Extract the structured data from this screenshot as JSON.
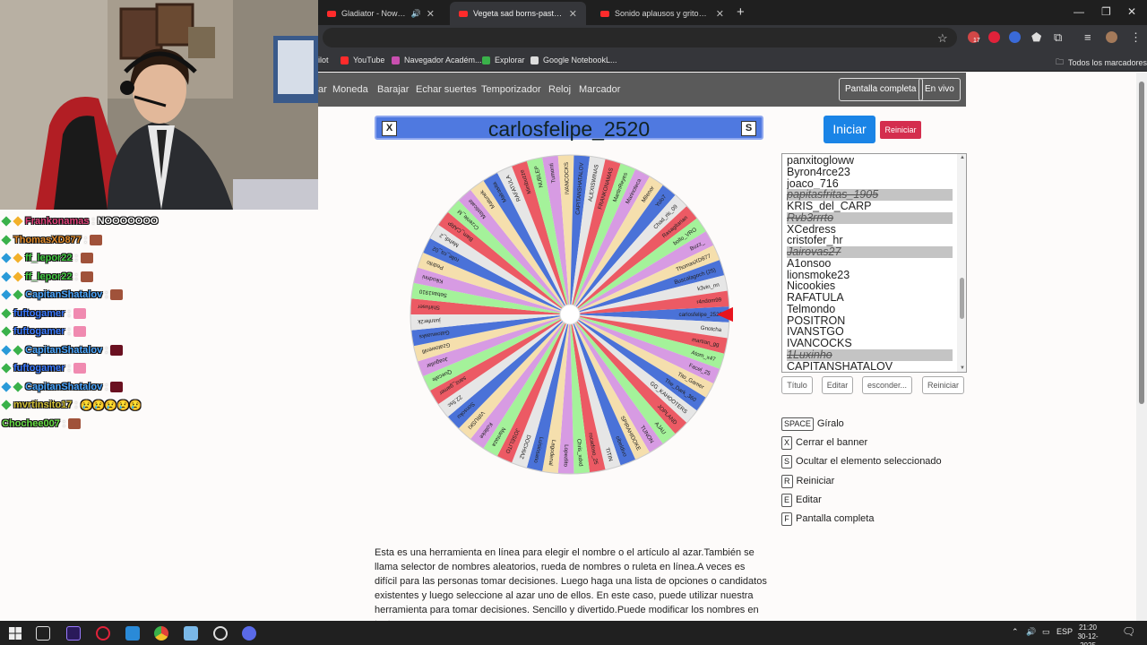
{
  "browser": {
    "tabs": [
      {
        "title": "Gladiator - Now We Are Free",
        "audio": true,
        "active": false
      },
      {
        "title": "Vegeta sad borns-past live (slowed)",
        "audio": false,
        "active": true
      },
      {
        "title": "Sonido aplausos y gritos del público",
        "audio": false,
        "active": false
      }
    ],
    "new_tab": "+",
    "window_controls": {
      "minimize": "—",
      "restore": "❐",
      "close": "✕"
    },
    "bookmarks": [
      {
        "label": "ilot",
        "color": "#6aa0ff"
      },
      {
        "label": "YouTube",
        "color": "#ff2b2b"
      },
      {
        "label": "Navegador Académ...",
        "color": "#c94fb0"
      },
      {
        "label": "Explorar",
        "color": "#3ab14a"
      },
      {
        "label": "Google NotebookL...",
        "color": "#dddddd"
      }
    ],
    "all_bookmarks": "Todos los marcadores",
    "extension_badge": "17"
  },
  "nav": {
    "links": [
      "ar",
      "Moneda",
      "Barajar",
      "Echar suertes",
      "Temporizador",
      "Reloj",
      "Marcador"
    ],
    "fullscreen_button": "Pantalla completa",
    "live_button": "En vivo"
  },
  "banner": {
    "title": "carlosfelipe_2520",
    "close_key": "X",
    "hide_key": "S"
  },
  "wheel": {
    "colors": [
      "#4a72d8",
      "#e6e6e6",
      "#ec5a64",
      "#a4f29a",
      "#d79be3",
      "#f5dfad"
    ],
    "pointer_color": "#e8141e",
    "selected": "carlosfelipe_2520",
    "labels": [
      "carlosfelipe_2520",
      "Gnotcha",
      "martian_gg",
      "Atom_x47",
      "Facel_25",
      "Tito_Gamer",
      "The_Dark_360",
      "GG_KAHOOTERS",
      "JOPLAND",
      "AJAU",
      "TUNON",
      "SPIRAHIDOKE",
      "cibeldivo",
      "TITIN",
      "rocadoso_25",
      "Chris_xdxd",
      "Lopezlito",
      "Lagodenal",
      "Luisinsano",
      "DOCHIAZ",
      "JOSELITO",
      "Mantaza",
      "Kolleke",
      "VIRUSKI",
      "Sonsoku",
      "22.5sc",
      "sanz_gamer",
      "Quecafe",
      "Joaguilar",
      "Gzatowenlll",
      "Gatowuasks",
      "juanfer2k",
      "Shirfuser",
      "Sebas1910",
      "Kikodrini",
      "Pedrito",
      "rolle_ca_02",
      "Mehdi_2",
      "Bam_CARP",
      "Crzenie_M",
      "Masticate",
      "Matunek",
      "Malrasita",
      "RAFATULA",
      "Minibuzze",
      "NUBLEP",
      "Tumonti",
      "IVANCOCKS",
      "CAPITANSHATALOV",
      "ALEXISWINAS",
      "FRANKONAMAS",
      "MartinReyes",
      "Marinoteca",
      "Milenor",
      "Yolo7",
      "Chad_ris_09",
      "Rasagitarian",
      "bollo_VRO",
      "Buzz_",
      "ThomasXD877",
      "Buscalagoch (25)",
      "k3vin_nn",
      "r4ndom99"
    ]
  },
  "controls": {
    "start": "Iniciar",
    "reset": "Reiniciar"
  },
  "entries": [
    {
      "text": "panxitogloww",
      "struck": false
    },
    {
      "text": "Byron4rce23",
      "struck": false
    },
    {
      "text": "joaco_716",
      "struck": false
    },
    {
      "text": "papitasfritas_1905",
      "struck": true
    },
    {
      "text": "KRIS_del_CARP",
      "struck": false
    },
    {
      "text": "Rvb3rrrto",
      "struck": true
    },
    {
      "text": "XCedress",
      "struck": false
    },
    {
      "text": "cristofer_hr",
      "struck": false
    },
    {
      "text": "Jairovas27",
      "struck": true
    },
    {
      "text": "A1onsoo",
      "struck": false
    },
    {
      "text": "lionsmoke23",
      "struck": false
    },
    {
      "text": "Nicookies",
      "struck": false
    },
    {
      "text": "RAFATULA",
      "struck": false
    },
    {
      "text": "Telmondo",
      "struck": false
    },
    {
      "text": "POSITRON",
      "struck": false
    },
    {
      "text": "IVANSTGO",
      "struck": false
    },
    {
      "text": "IVANCOCKS",
      "struck": false
    },
    {
      "text": "1Luxinho",
      "struck": true
    },
    {
      "text": "CAPITANSHATALOV",
      "struck": false
    }
  ],
  "list_buttons": {
    "title": "Título",
    "edit": "Editar",
    "hide": "esconder...",
    "reset": "Reiniciar"
  },
  "shortcuts": [
    {
      "key": "SPACE",
      "label": "Gíralo"
    },
    {
      "key": "X",
      "label": "Cerrar el banner"
    },
    {
      "key": "S",
      "label": "Ocultar el elemento seleccionado"
    },
    {
      "key": "R",
      "label": "Reiniciar"
    },
    {
      "key": "E",
      "label": "Editar"
    },
    {
      "key": "F",
      "label": "Pantalla completa"
    }
  ],
  "description": "Esta es una herramienta en línea para elegir el nombre o el artículo al azar.También se llama selector de nombres aleatorios, rueda de nombres o ruleta en línea.A veces es difícil para las personas tomar decisiones. Luego haga una lista de opciones o candidatos existentes y luego seleccione al azar uno de ellos. En este caso, puede utilizar nuestra herramienta para tomar decisiones. Sencillo y divertido.Puede modificar los nombres en textarea, poner un",
  "chat": [
    {
      "user": "Frankonamas",
      "color": "#e0407a",
      "message": "NOOOOOOO",
      "badges": [
        "#3ab14a",
        "#f2b02a"
      ],
      "emotes": []
    },
    {
      "user": "ThomasXD877",
      "color": "#e08a2a",
      "message": "",
      "badges": [
        "#3ab14a"
      ],
      "emotes": [
        "#a0523a"
      ]
    },
    {
      "user": "ff_lepor22",
      "color": "#44cc44",
      "message": "",
      "badges": [
        "#2a9ad8",
        "#f2b02a"
      ],
      "emotes": [
        "#a0523a"
      ]
    },
    {
      "user": "ff_lepor22",
      "color": "#44cc44",
      "message": "",
      "badges": [
        "#2a9ad8",
        "#f2b02a"
      ],
      "emotes": [
        "#a0523a"
      ]
    },
    {
      "user": "CapitanShatalov",
      "color": "#4aa6ff",
      "message": "",
      "badges": [
        "#2a9ad8",
        "#3ab14a"
      ],
      "emotes": [
        "#a0523a"
      ]
    },
    {
      "user": "fuftogamer",
      "color": "#3a7aff",
      "message": "",
      "badges": [
        "#3ab14a"
      ],
      "emotes": [
        "#f08ab0"
      ]
    },
    {
      "user": "fuftogamer",
      "color": "#3a7aff",
      "message": "",
      "badges": [
        "#3ab14a"
      ],
      "emotes": [
        "#f08ab0"
      ]
    },
    {
      "user": "CapitanShatalov",
      "color": "#4aa6ff",
      "message": "",
      "badges": [
        "#2a9ad8",
        "#3ab14a"
      ],
      "emotes": [
        "#6a1020"
      ]
    },
    {
      "user": "fuftogamer",
      "color": "#3a7aff",
      "message": "",
      "badges": [
        "#3ab14a"
      ],
      "emotes": [
        "#f08ab0"
      ]
    },
    {
      "user": "CapitanShatalov",
      "color": "#4aa6ff",
      "message": "",
      "badges": [
        "#2a9ad8",
        "#3ab14a"
      ],
      "emotes": [
        "#6a1020"
      ]
    },
    {
      "user": "mvrtinsito17",
      "color": "#d6c43a",
      "message": "😢😢😢😢😢",
      "badges": [
        "#3ab14a"
      ],
      "emotes": []
    },
    {
      "user": "Chochee007",
      "color": "#66dd44",
      "message": "",
      "badges": [],
      "emotes": [
        "#a0523a"
      ]
    }
  ],
  "taskbar": {
    "language": "ESP",
    "time": "21:20",
    "date": "30-12-2025"
  }
}
